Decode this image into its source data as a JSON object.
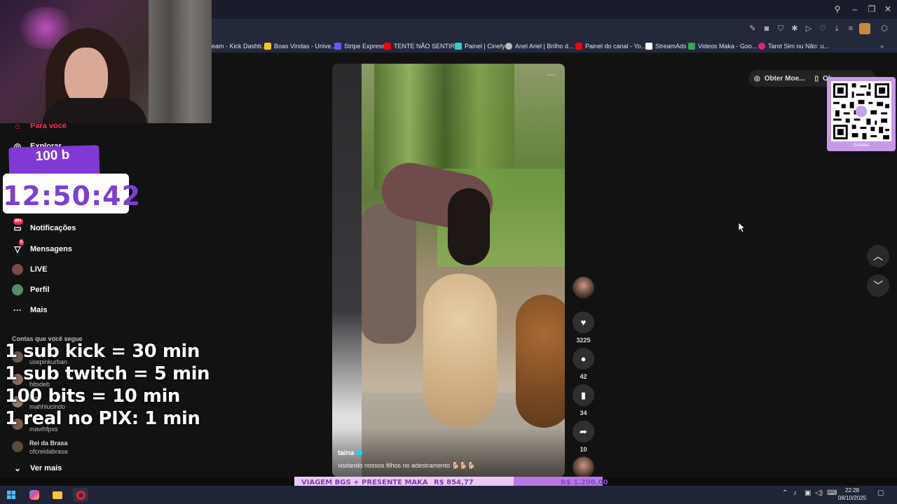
{
  "bookmarks": [
    {
      "label": "eam - Kick Dashb...",
      "color": "#53fc18"
    },
    {
      "label": "Boas Vindas - Unive...",
      "color": "#f5c518"
    },
    {
      "label": "Stripe Express",
      "color": "#635bff"
    },
    {
      "label": "TENTE NÃO SENTIR...",
      "color": "#ff0000"
    },
    {
      "label": "Painel | Cinefy",
      "color": "#2ad1d1"
    },
    {
      "label": "Anel Ariel | Brilho d...",
      "color": "#bbbbbb"
    },
    {
      "label": "Painel do canal - Yo...",
      "color": "#ff0000"
    },
    {
      "label": "StreamAds",
      "color": "#ffffff"
    },
    {
      "label": "Videos Maka - Goo...",
      "color": "#34a853"
    },
    {
      "label": "Tarot Sim ou Não: u...",
      "color": "#e2227a"
    }
  ],
  "sidebar": {
    "for_you": "Para você",
    "explore": "Explorar",
    "notifications": "Notificações",
    "notifications_badge": "99+",
    "messages": "Mensagens",
    "messages_badge": "5",
    "live": "LIVE",
    "profile": "Perfil",
    "more": "Mais",
    "following_header": "Contas que você segue",
    "following": [
      {
        "name": "",
        "user": "usepinkurban"
      },
      {
        "name": "",
        "user": "hitsdeb"
      },
      {
        "name": "Ma",
        "user": "mahhlucindo"
      },
      {
        "name": "",
        "user": "mavihfpss"
      },
      {
        "name": "Rei da Brasa",
        "user": "ofcreidabrasa"
      }
    ],
    "see_more": "Ver mais"
  },
  "widget": {
    "bits": "100 b",
    "timer": "12:50:42"
  },
  "rules": [
    "1 sub kick = 30 min",
    "1 sub twitch = 5 min",
    "100 bits = 10 min",
    "1 real no PIX: 1 min"
  ],
  "video": {
    "username": "taina",
    "caption": "visitando nossos filhos no adestramento 🐕🐕🐕"
  },
  "actions": {
    "likes": "3225",
    "comments": "42",
    "saves": "34",
    "shares": "10"
  },
  "top_right": {
    "coins": "Obter Moe...",
    "app": "Ob"
  },
  "qr": {
    "label": "EuMaka"
  },
  "goal": {
    "title": "VIAGEM BGS + PRESENTE MAKA",
    "current": "R$ 854,77",
    "target": "R$ 1.200,00",
    "progress": 0.712
  },
  "taskbar": {
    "time": "22:28",
    "date": "08/10/2025"
  },
  "colors": {
    "tiktok_red": "#fe2c55",
    "goal_purple": "#b978e6",
    "timer_purple": "#7c3fd4"
  }
}
